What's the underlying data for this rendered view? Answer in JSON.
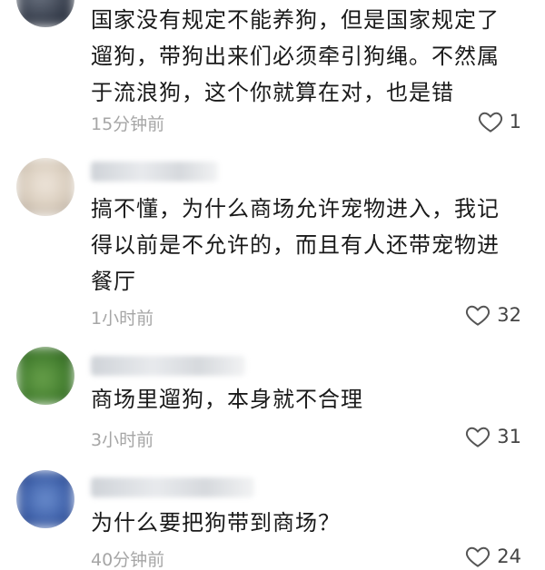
{
  "comments": [
    {
      "text": "国家没有规定不能养狗，但是国家规定了遛狗，带狗出来们必须牵引狗绳。不然属于流浪狗，这个你就算在对，也是错",
      "time": "15分钟前",
      "likes": "1",
      "avatar_icon": "blurred-avatar-icon"
    },
    {
      "text": "搞不懂，为什么商场允许宠物进入，我记得以前是不允许的，而且有人还带宠物进餐厅",
      "time": "1小时前",
      "likes": "32",
      "avatar_icon": "blurred-avatar-icon"
    },
    {
      "text": "商场里遛狗，本身就不合理",
      "time": "3小时前",
      "likes": "31",
      "avatar_icon": "blurred-avatar-icon"
    },
    {
      "text": "为什么要把狗带到商场？",
      "time": "40分钟前",
      "likes": "24",
      "avatar_icon": "blurred-avatar-icon"
    }
  ],
  "colors": {
    "text": "#1a1a1a",
    "meta": "#a6a6a6",
    "icon": "#555555"
  }
}
